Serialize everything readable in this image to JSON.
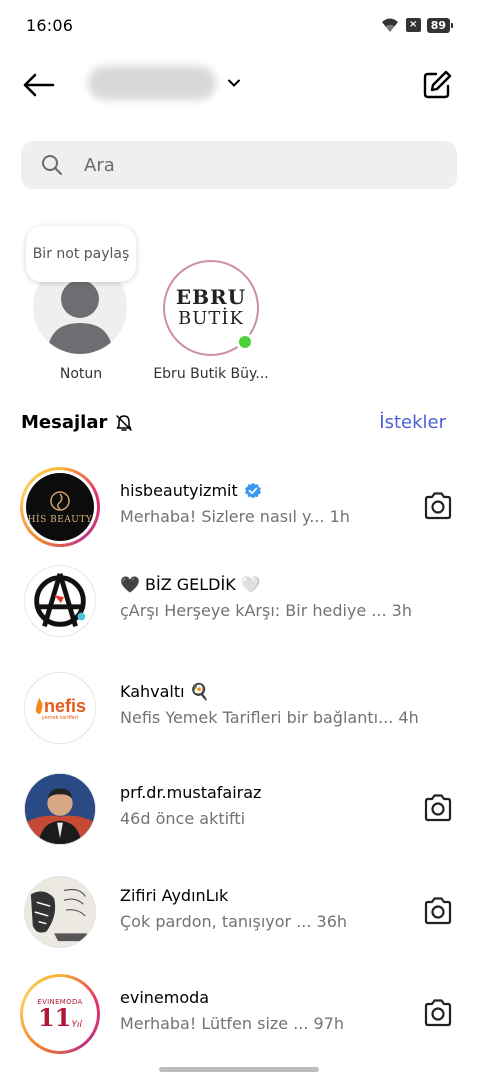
{
  "status": {
    "time": "16:06",
    "sim": "×",
    "battery": "89"
  },
  "search": {
    "placeholder": "Ara"
  },
  "notes": [
    {
      "bubble": "Bir not paylaş",
      "label": "Notun"
    },
    {
      "label": "Ebru Butik Büy...",
      "logo_line1": "EBRU",
      "logo_line2": "BUTİK",
      "online": true
    }
  ],
  "section": {
    "title": "Mesajlar",
    "requests": "İstekler"
  },
  "threads": [
    {
      "name": "hisbeautyizmit",
      "verified": true,
      "preview": "Merhaba! Sizlere nasıl y... 1h",
      "camera": true,
      "avatar_text": "HİS BEAUTY"
    },
    {
      "name": "🖤 BİZ GELDİK 🤍",
      "preview": "çArşı Herşeye kArşı: Bir hediye ... 3h",
      "camera": false
    },
    {
      "name": "Kahvaltı 🍳",
      "preview": "Nefis Yemek Tarifleri bir bağlantı... 4h",
      "camera": false,
      "avatar_text": "nefis",
      "avatar_sub": "yemek tarifleri"
    },
    {
      "name": "prf.dr.mustafairaz",
      "preview": "46d önce aktifti",
      "camera": true
    },
    {
      "name": "Zifiri AydınLık",
      "preview": "Çok pardon, tanışıyor ... 36h",
      "camera": true
    },
    {
      "name": "evinemoda",
      "preview": "Merhaba! Lütfen size ... 97h",
      "camera": true,
      "avatar_text": "EVINEMODA",
      "avatar_big": "11",
      "avatar_small": "Yıl"
    }
  ],
  "colors": {
    "accent": "#4a5fd8",
    "online": "#4ed23c",
    "verified": "#3897f0"
  }
}
